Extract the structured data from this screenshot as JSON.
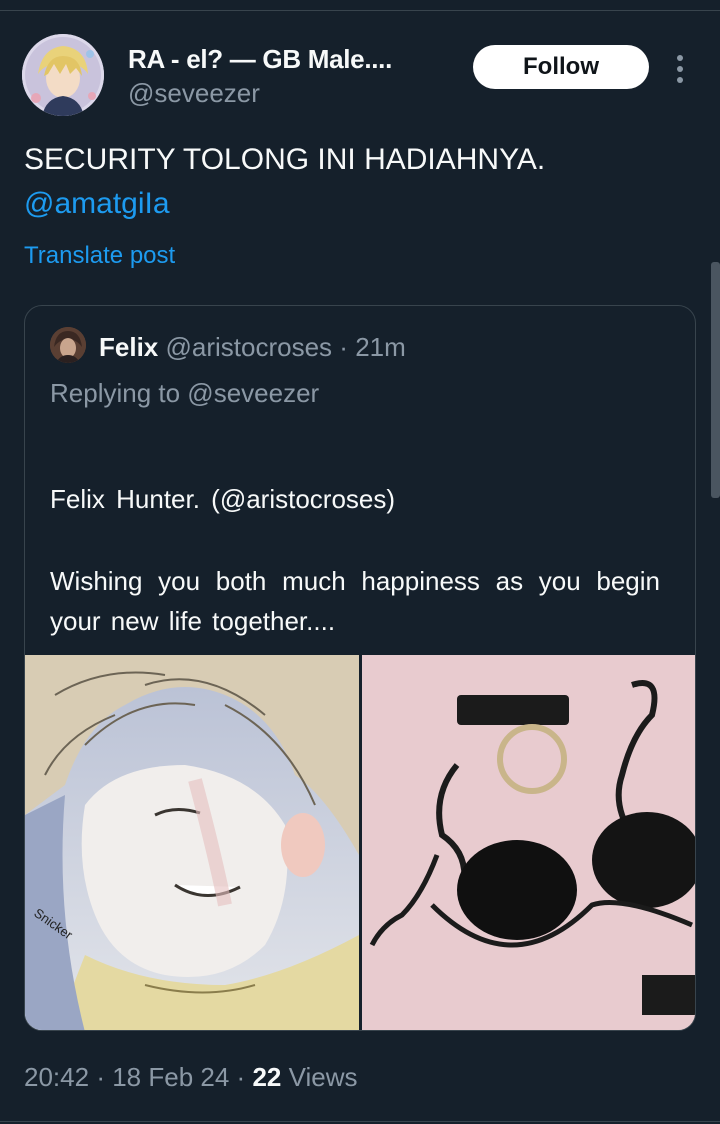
{
  "author": {
    "display_name": "RA - el? — GB Male....",
    "handle": "@seveezer",
    "follow_label": "Follow"
  },
  "tweet": {
    "text": "SECURITY TOLONG INI HADIAHNYA.",
    "mention": "@amatgiIa",
    "translate_label": "Translate post"
  },
  "quoted": {
    "name": "Felix",
    "handle": "@aristocroses",
    "separator": "·",
    "time": "21m",
    "replying_to": "Replying to @seveezer",
    "line1": "Felix Hunter. (@aristocroses)",
    "body": "Wishing you both much happiness as you begin your new life together....",
    "media_left_caption": "Snicker"
  },
  "footer": {
    "time": "20:42",
    "sep1": "·",
    "date": "18 Feb 24",
    "sep2": "·",
    "views_count": "22",
    "views_label": "Views"
  },
  "colors": {
    "background": "#15202b",
    "accent": "#1d9bf0",
    "muted": "#8b98a5",
    "border": "#38444d"
  },
  "icons": [
    "more-vertical-icon"
  ]
}
